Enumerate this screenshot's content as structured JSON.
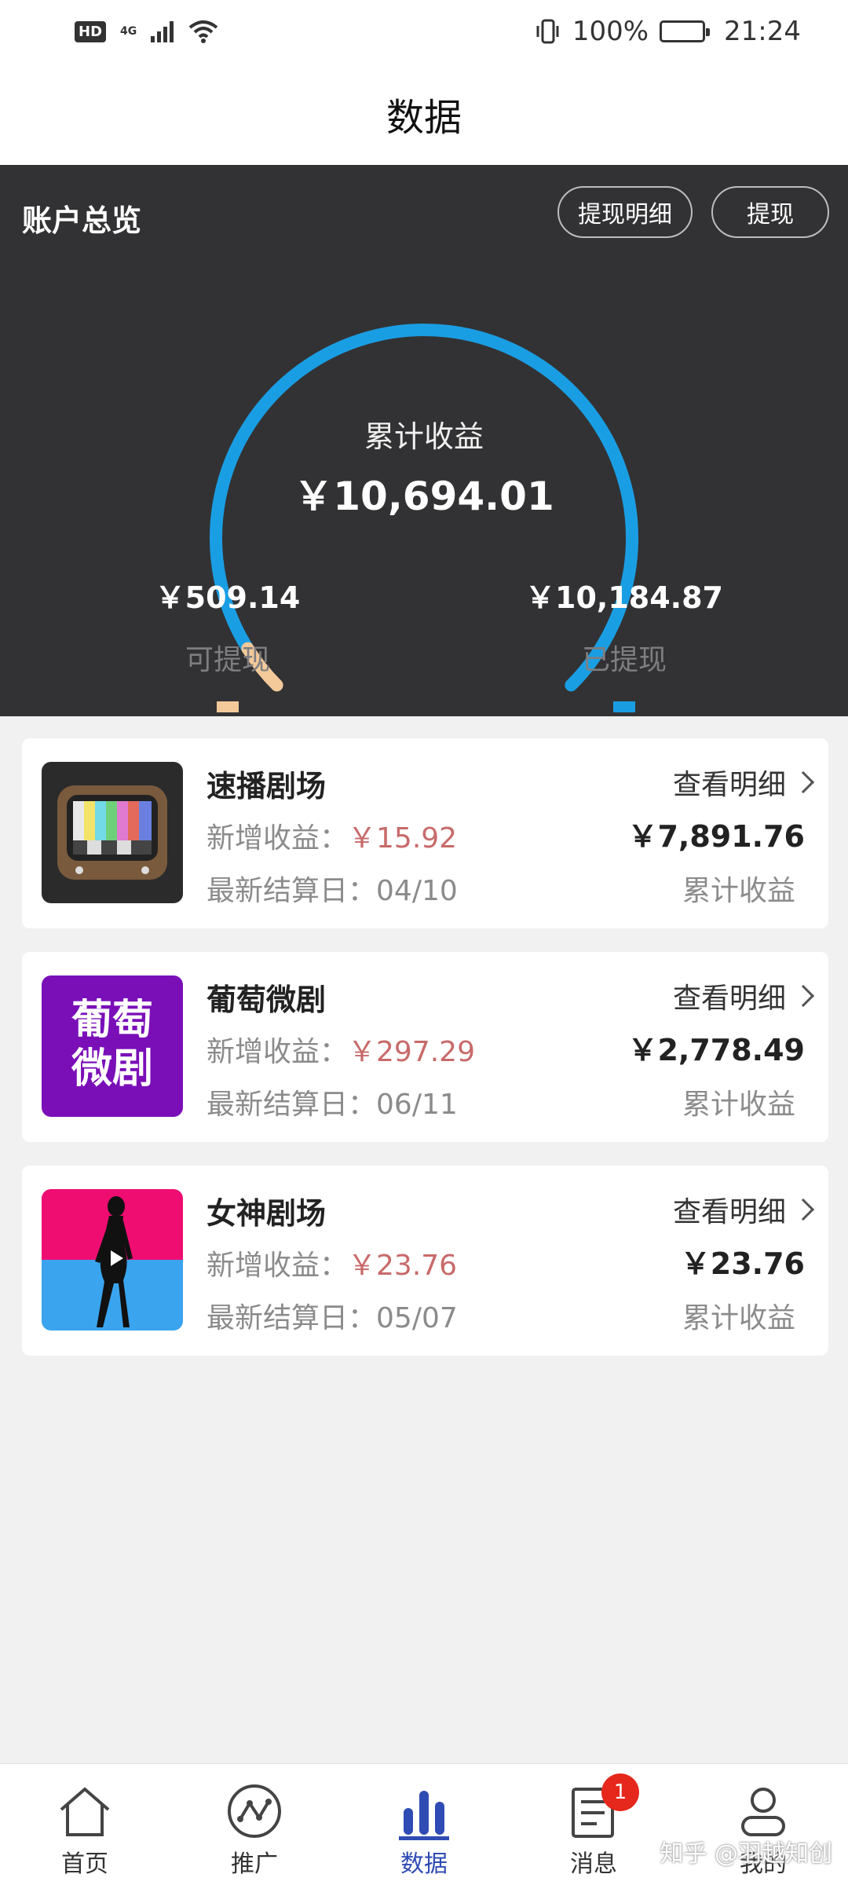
{
  "status_bar": {
    "hd": "HD",
    "network": "4G",
    "battery": "100%",
    "time": "21:24"
  },
  "title": "数据",
  "overview": {
    "title": "账户总览",
    "buttons": {
      "detail": "提现明细",
      "withdraw": "提现"
    },
    "center_label": "累计收益",
    "center_value": "￥10,694.01",
    "left_amount": "￥509.14",
    "left_label": "可提现",
    "right_amount": "￥10,184.87",
    "right_label": "已提现",
    "colors": {
      "withdrawable": "#f3c99a",
      "withdrawn": "#1a9ee3",
      "background": "#323234"
    },
    "withdrawable_fraction": 0.048
  },
  "cards": [
    {
      "name": "速播剧场",
      "thumb_icon": "retro-tv-icon",
      "new_label": "新增收益：",
      "new_value": "￥15.92",
      "settle_label": "最新结算日：",
      "settle_date": "04/10",
      "detail_link": "查看明细",
      "total": "￥7,891.76",
      "total_label": "累计收益"
    },
    {
      "name": "葡萄微剧",
      "thumb_text_line1": "葡萄",
      "thumb_text_line2": "微剧",
      "new_label": "新增收益：",
      "new_value": "￥297.29",
      "settle_label": "最新结算日：",
      "settle_date": "06/11",
      "detail_link": "查看明细",
      "total": "￥2,778.49",
      "total_label": "累计收益"
    },
    {
      "name": "女神剧场",
      "thumb_icon": "silhouette-play-icon",
      "new_label": "新增收益：",
      "new_value": "￥23.76",
      "settle_label": "最新结算日：",
      "settle_date": "05/07",
      "detail_link": "查看明细",
      "total": "￥23.76",
      "total_label": "累计收益"
    }
  ],
  "tabs": [
    {
      "label": "首页",
      "icon": "home-icon"
    },
    {
      "label": "推广",
      "icon": "promote-icon"
    },
    {
      "label": "数据",
      "icon": "bar-chart-icon",
      "active": true
    },
    {
      "label": "消息",
      "icon": "message-icon",
      "badge": "1"
    },
    {
      "label": "我的",
      "icon": "profile-icon"
    }
  ],
  "watermark": "知乎 @羽越知创"
}
